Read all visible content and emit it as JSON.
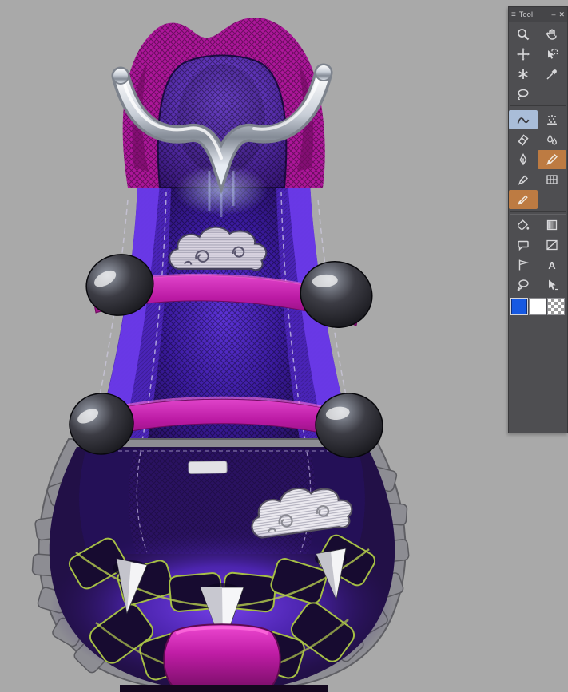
{
  "app": {
    "canvas_background": "#a9a9a9"
  },
  "tool_panel": {
    "title": "Tool",
    "menu_icon": "≡",
    "minimize_label": "–",
    "close_label": "✕",
    "selected_tool": "figure",
    "active_subtools": [
      "pencil",
      "brush-pen"
    ],
    "highlight_colors": {
      "selected": "#a9bdd8",
      "active_sub": "#bd7b42"
    },
    "groups": [
      {
        "tools": [
          {
            "name": "zoom"
          },
          {
            "name": "hand"
          },
          {
            "name": "move"
          },
          {
            "name": "object-select"
          },
          {
            "name": "blend-star"
          },
          {
            "name": "eyedropper"
          },
          {
            "name": "lasso"
          },
          null
        ]
      },
      {
        "tools": [
          {
            "name": "figure",
            "state": "selected"
          },
          {
            "name": "decoration"
          },
          {
            "name": "eraser"
          },
          {
            "name": "blend-drops"
          },
          {
            "name": "pen"
          },
          {
            "name": "pencil",
            "state": "active-sub"
          },
          {
            "name": "marker"
          },
          {
            "name": "grid"
          },
          {
            "name": "brush-pen",
            "state": "active-sub"
          },
          null
        ]
      },
      {
        "tools": [
          {
            "name": "fill-bucket"
          },
          {
            "name": "gradient"
          },
          {
            "name": "balloon"
          },
          {
            "name": "frame-border"
          },
          {
            "name": "polyline"
          },
          {
            "name": "text",
            "glyph": "A"
          },
          {
            "name": "thought-balloon"
          },
          {
            "name": "select-arrow"
          }
        ]
      }
    ],
    "swatches": {
      "primary": {
        "color": "#1659e2",
        "selected": true
      },
      "secondary": {
        "color": "#ffffff"
      },
      "transparent": {
        "checker": true
      }
    }
  },
  "artwork_palette": {
    "body_purple": "#4a24b8",
    "accent_magenta": "#b5189e",
    "sole_gray": "#8d8d93",
    "piping_green": "#aabf3f"
  }
}
